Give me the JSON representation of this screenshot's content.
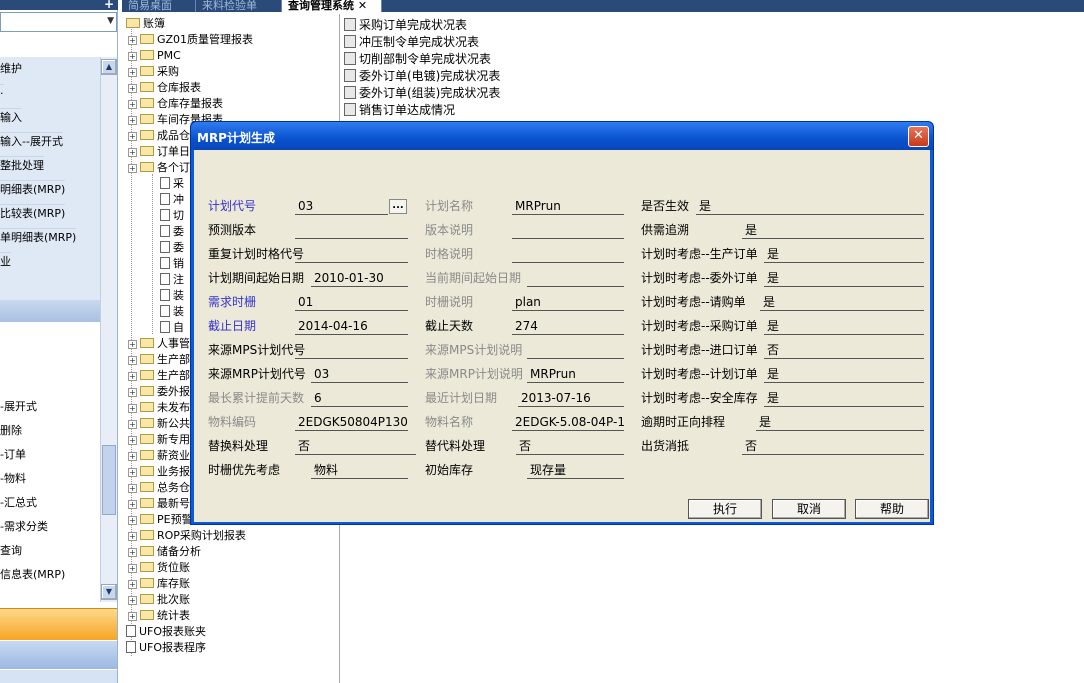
{
  "tabs": [
    "简易桌面",
    "来料检验单",
    "查询管理系统"
  ],
  "left_nav": {
    "top_items": [
      "维护",
      "·",
      "输入",
      "输入--展开式",
      "整批处理",
      "明细表(MRP)",
      "比较表(MRP)",
      "单明细表(MRP)",
      "业"
    ],
    "bottom_items": [
      "-展开式",
      "删除",
      "-订单",
      "-物料",
      "-汇总式",
      "-需求分类",
      "查询",
      "信息表(MRP)"
    ]
  },
  "tree": {
    "root": "账簿",
    "nodes": [
      "GZ01质量管理报表",
      "PMC",
      "采购",
      "仓库报表",
      "仓库存量报表",
      "车间存量报表",
      "成品仓",
      "订单日",
      "各个订"
    ],
    "sub_items": [
      "采",
      "冲",
      "切",
      "委",
      "委",
      "销",
      "注",
      "装",
      "装",
      "自"
    ],
    "nodes2": [
      "人事管",
      "生产部",
      "生产部",
      "委外报",
      "未发布",
      "新公共",
      "新专用",
      "薪资业",
      "业务报",
      "总务仓",
      "最新号",
      "PE预警",
      "ROP采购计划报表",
      "储备分析",
      "货位账",
      "库存账",
      "批次账",
      "统计表"
    ],
    "files": [
      "UFO报表账夹",
      "UFO报表程序"
    ]
  },
  "right_list": [
    "采购订单完成状况表",
    "冲压制令单完成状况表",
    "切削部制令单完成状况表",
    "委外订单(电镀)完成状况表",
    "委外订单(组装)完成状况表",
    "销售订单达成情况"
  ],
  "dialog": {
    "title": "MRP计划生成",
    "close": "✕",
    "col1": [
      {
        "label": "计划代号",
        "value": "03",
        "style": "blue"
      },
      {
        "label": "预测版本",
        "value": "",
        "style": ""
      },
      {
        "label": "重复计划时格代号",
        "value": "",
        "style": ""
      },
      {
        "label": "计划期间起始日期",
        "value": "2010-01-30",
        "style": ""
      },
      {
        "label": "需求时栅",
        "value": "01",
        "style": "blue"
      },
      {
        "label": "截止日期",
        "value": "2014-04-16",
        "style": "blue"
      },
      {
        "label": "来源MPS计划代号",
        "value": "",
        "style": ""
      },
      {
        "label": "来源MRP计划代号",
        "value": "03",
        "style": ""
      },
      {
        "label": "最长累计提前天数",
        "value": "6",
        "style": "gray"
      },
      {
        "label": "物料编码",
        "value": "2EDGK50804P1300",
        "style": "gray"
      },
      {
        "label": "替换料处理",
        "value": "否",
        "style": ""
      },
      {
        "label": "时栅优先考虑",
        "value": "物料",
        "style": ""
      }
    ],
    "col2": [
      {
        "label": "计划名称",
        "value": "MRPrun",
        "style": "gray"
      },
      {
        "label": "版本说明",
        "value": "",
        "style": "gray"
      },
      {
        "label": "时格说明",
        "value": "",
        "style": "gray"
      },
      {
        "label": "当前期间起始日期",
        "value": "",
        "style": "gray"
      },
      {
        "label": "时栅说明",
        "value": "plan",
        "style": "gray"
      },
      {
        "label": "截止天数",
        "value": "274",
        "style": ""
      },
      {
        "label": "来源MPS计划说明",
        "value": "",
        "style": "gray"
      },
      {
        "label": "来源MRP计划说明",
        "value": "MRPrun",
        "style": "gray"
      },
      {
        "label": "最近计划日期",
        "value": "2013-07-16",
        "style": "gray"
      },
      {
        "label": "物料名称",
        "value": "2EDGK-5.08-04P-13",
        "style": "gray"
      },
      {
        "label": "替代料处理",
        "value": "否",
        "style": ""
      },
      {
        "label": "初始库存",
        "value": "现存量",
        "style": ""
      }
    ],
    "col3": [
      {
        "label": "是否生效",
        "value": "是"
      },
      {
        "label": "供需追溯",
        "value": "是"
      },
      {
        "label": "计划时考虑--生产订单",
        "value": "是"
      },
      {
        "label": "计划时考虑--委外订单",
        "value": "是"
      },
      {
        "label": "计划时考虑--请购单",
        "value": "是"
      },
      {
        "label": "计划时考虑--采购订单",
        "value": "是"
      },
      {
        "label": "计划时考虑--进口订单",
        "value": "否"
      },
      {
        "label": "计划时考虑--计划订单",
        "value": "是"
      },
      {
        "label": "计划时考虑--安全库存",
        "value": "是"
      },
      {
        "label": "逾期时正向排程",
        "value": "是"
      },
      {
        "label": "出货消抵",
        "value": "否"
      }
    ],
    "ellipsis": "...",
    "buttons": {
      "execute": "执行",
      "cancel": "取消",
      "help": "帮助"
    }
  }
}
